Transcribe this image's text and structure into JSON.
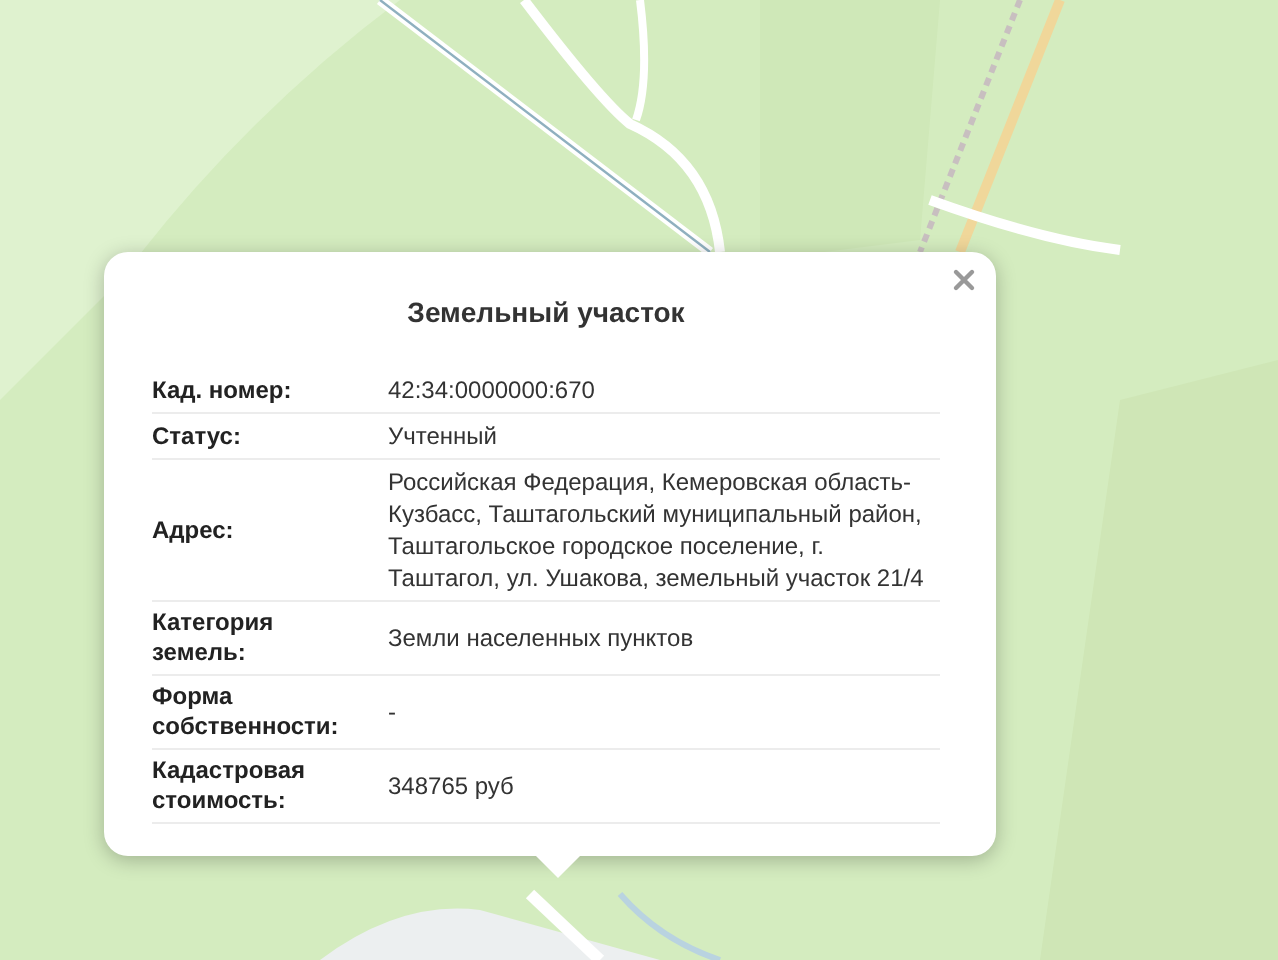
{
  "popup": {
    "title": "Земельный участок",
    "rows": [
      {
        "label": "Кад. номер:",
        "value": "42:34:0000000:670"
      },
      {
        "label": "Статус:",
        "value": "Учтенный"
      },
      {
        "label": "Адрес:",
        "value": "Российская Федерация, Кемеровская область-Кузбасс, Таштагольский муниципальный район, Таштагольское городское поселение, г. Таштагол, ул. Ушакова, земельный участок 21/4"
      },
      {
        "label": "Категория земель:",
        "value": "Земли населенных пунктов"
      },
      {
        "label": "Форма собственности:",
        "value": "-"
      },
      {
        "label": "Кадастровая стоимость:",
        "value": "348765 руб"
      }
    ]
  }
}
